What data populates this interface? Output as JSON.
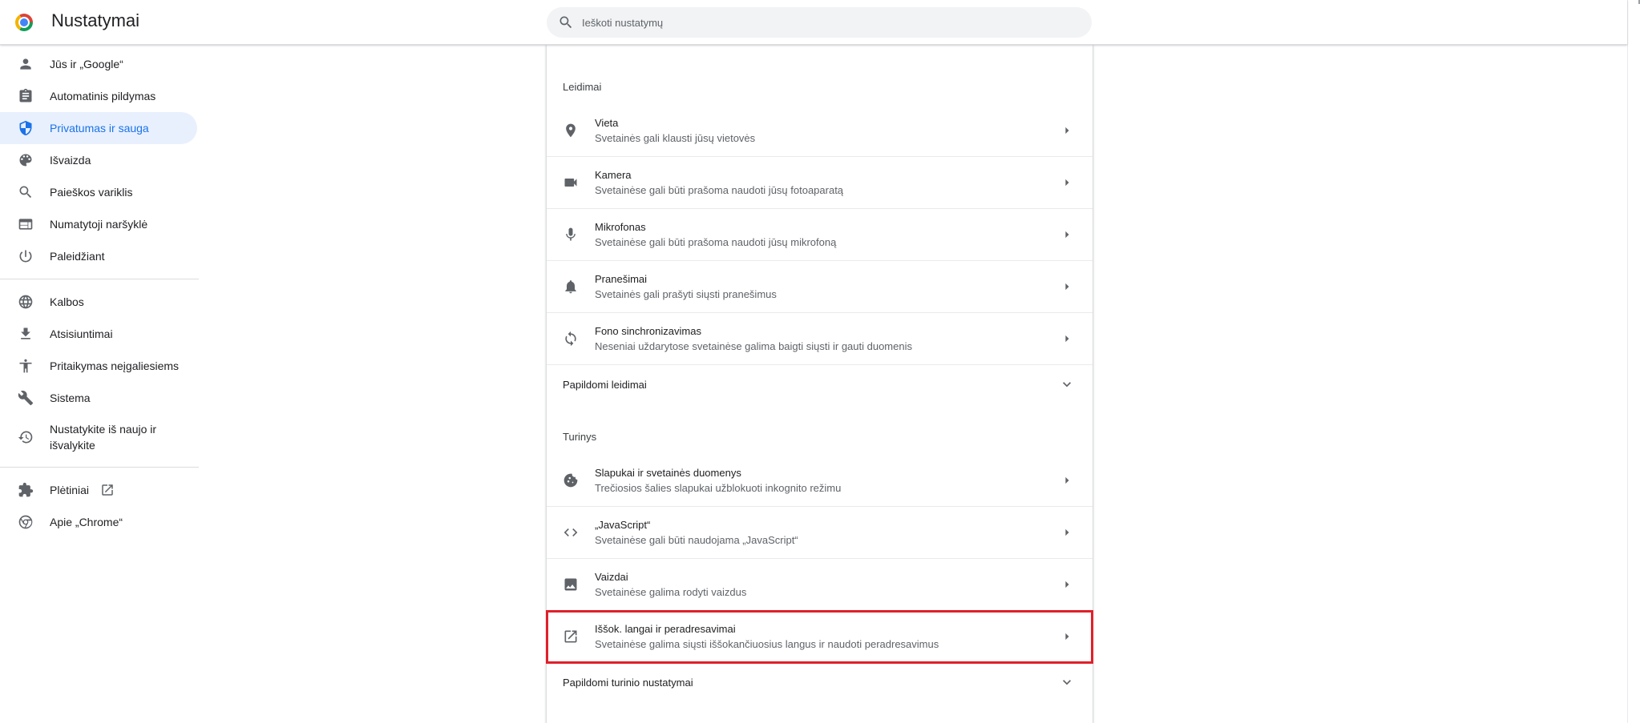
{
  "header": {
    "title": "Nustatymai",
    "search_placeholder": "Ieškoti nustatymų"
  },
  "sidebar": {
    "items": [
      {
        "label": "Jūs ir „Google“",
        "icon": "person-icon"
      },
      {
        "label": "Automatinis pildymas",
        "icon": "clipboard-icon"
      },
      {
        "label": "Privatumas ir sauga",
        "icon": "shield-icon",
        "active": true
      },
      {
        "label": "Išvaizda",
        "icon": "palette-icon"
      },
      {
        "label": "Paieškos variklis",
        "icon": "search-icon"
      },
      {
        "label": "Numatytoji naršyklė",
        "icon": "browser-icon"
      },
      {
        "label": "Paleidžiant",
        "icon": "power-icon"
      },
      {
        "label": "Kalbos",
        "icon": "globe-icon"
      },
      {
        "label": "Atsisiuntimai",
        "icon": "download-icon"
      },
      {
        "label": "Pritaikymas neįgaliesiems",
        "icon": "accessibility-icon"
      },
      {
        "label": "Sistema",
        "icon": "wrench-icon"
      },
      {
        "label": "Nustatykite iš naujo ir išvalykite",
        "icon": "restore-icon"
      },
      {
        "label": "Plėtiniai",
        "icon": "puzzle-icon"
      },
      {
        "label": "Apie „Chrome“",
        "icon": "chrome-icon"
      }
    ]
  },
  "main": {
    "permissions_title": "Leidimai",
    "permissions": [
      {
        "label": "Vieta",
        "sublabel": "Svetainės gali klausti jūsų vietovės",
        "icon": "location-icon"
      },
      {
        "label": "Kamera",
        "sublabel": "Svetainėse gali būti prašoma naudoti jūsų fotoaparatą",
        "icon": "camera-icon"
      },
      {
        "label": "Mikrofonas",
        "sublabel": "Svetainėse gali būti prašoma naudoti jūsų mikrofoną",
        "icon": "microphone-icon"
      },
      {
        "label": "Pranešimai",
        "sublabel": "Svetainės gali prašyti siųsti pranešimus",
        "icon": "bell-icon"
      },
      {
        "label": "Fono sinchronizavimas",
        "sublabel": "Neseniai uždarytose svetainėse galima baigti siųsti ir gauti duomenis",
        "icon": "sync-icon"
      }
    ],
    "more_permissions": "Papildomi leidimai",
    "content_title": "Turinys",
    "content": [
      {
        "label": "Slapukai ir svetainės duomenys",
        "sublabel": "Trečiosios šalies slapukai užblokuoti inkognito režimu",
        "icon": "cookie-icon"
      },
      {
        "label": "„JavaScript“",
        "sublabel": "Svetainėse gali būti naudojama „JavaScript“",
        "icon": "code-icon"
      },
      {
        "label": "Vaizdai",
        "sublabel": "Svetainėse galima rodyti vaizdus",
        "icon": "image-icon"
      },
      {
        "label": "Iššok. langai ir peradresavimai",
        "sublabel": "Svetainėse galima siųsti iššokančiuosius langus ir naudoti peradresavimus",
        "icon": "open-in-new-icon",
        "highlighted": true
      }
    ],
    "more_content": "Papildomi turinio nustatymai"
  },
  "colors": {
    "accent": "#1a73e8",
    "active_bg": "#e8f0fe",
    "highlight_border": "#e0202a"
  }
}
